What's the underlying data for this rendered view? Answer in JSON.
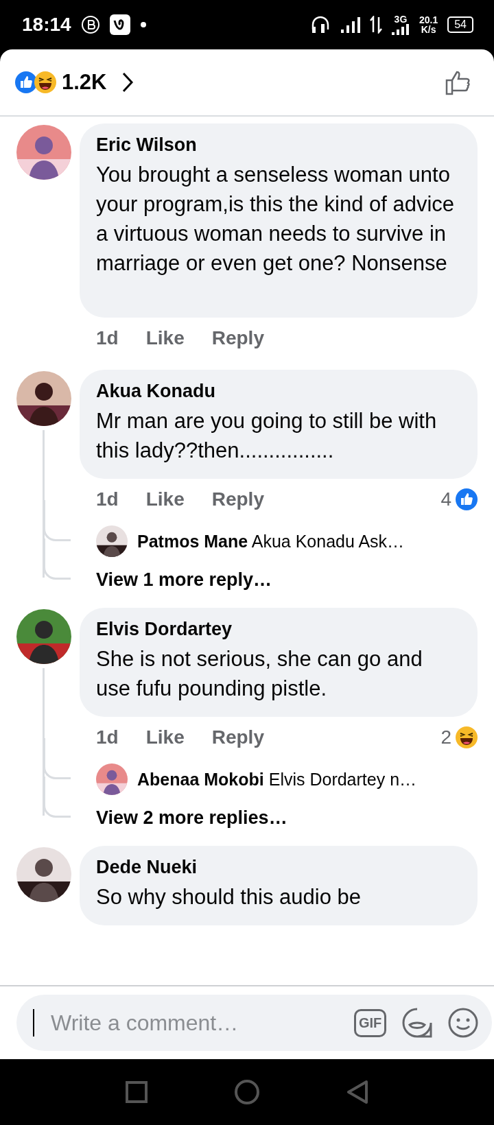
{
  "status_bar": {
    "time": "18:14",
    "network": "3G",
    "speed_value": "20.1",
    "speed_unit": "K/s",
    "battery": "54"
  },
  "header": {
    "reactions": [
      {
        "kind": "like"
      },
      {
        "kind": "haha"
      }
    ],
    "count": "1.2K"
  },
  "comments": [
    {
      "author": "Eric Wilson",
      "text": "You brought a senseless woman unto your program,is this the kind of advice a virtuous woman needs to survive in marriage or even get one? Nonsense",
      "time": "1d",
      "like": "Like",
      "reply": "Reply"
    },
    {
      "author": "Akua Konadu",
      "text": "Mr man are you going to still be with this lady??then................",
      "time": "1d",
      "like": "Like",
      "reply": "Reply",
      "reaction": {
        "kind": "like",
        "count": "4"
      },
      "replies": [
        {
          "author": "Patmos Mane",
          "text": "Akua Konadu Ask…"
        }
      ],
      "more": "View 1 more reply…"
    },
    {
      "author": "Elvis Dordartey",
      "text": "She is not serious, she can go and use fufu  pounding pistle.",
      "time": "1d",
      "like": "Like",
      "reply": "Reply",
      "reaction": {
        "kind": "haha",
        "count": "2"
      },
      "replies": [
        {
          "author": "Abenaa Mokobi",
          "text": "Elvis Dordartey n…"
        }
      ],
      "more": "View 2 more replies…"
    },
    {
      "author": "Dede Nueki",
      "text": "So why should this audio be"
    }
  ],
  "composer": {
    "placeholder": "Write a comment…",
    "focused": true,
    "gif": "GIF"
  }
}
